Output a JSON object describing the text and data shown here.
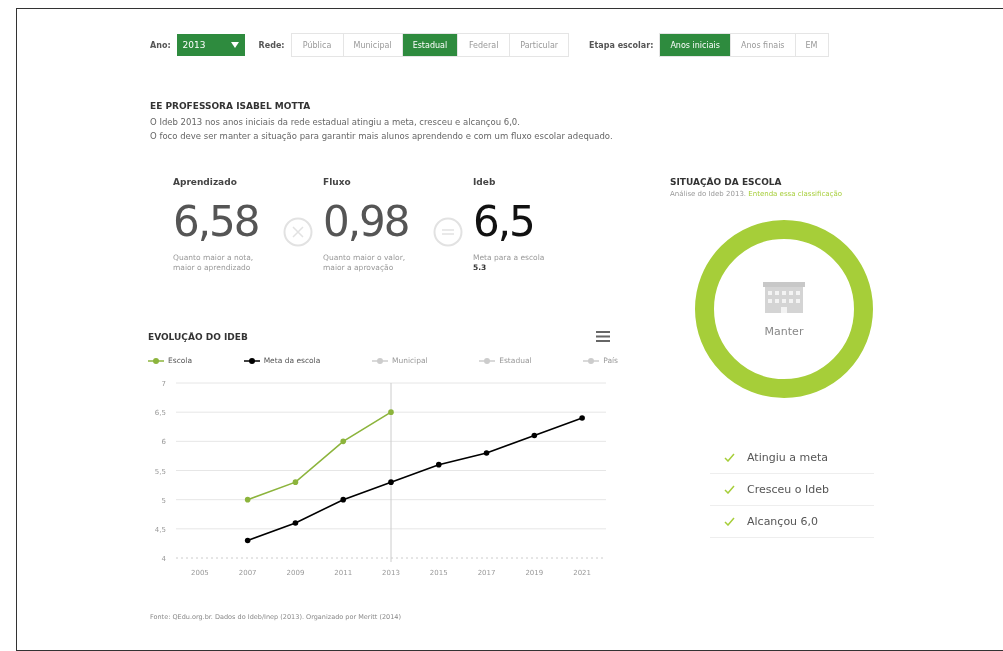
{
  "filters": {
    "year": {
      "label": "Ano:",
      "value": "2013"
    },
    "network": {
      "label": "Rede:",
      "options": [
        {
          "label": "Pública",
          "selected": false
        },
        {
          "label": "Municipal",
          "selected": false
        },
        {
          "label": "Estadual",
          "selected": true
        },
        {
          "label": "Federal",
          "selected": false
        },
        {
          "label": "Particular",
          "selected": false
        }
      ]
    },
    "stage": {
      "label": "Etapa escolar:",
      "options": [
        {
          "label": "Anos iniciais",
          "selected": true
        },
        {
          "label": "Anos finais",
          "selected": false
        },
        {
          "label": "EM",
          "selected": false
        }
      ]
    }
  },
  "school": {
    "name": "EE PROFESSORA ISABEL MOTTA",
    "lines": [
      "O Ideb 2013 nos anos iniciais da rede estadual atingiu a meta, cresceu e alcançou 6,0.",
      "O foco deve ser manter a situação para garantir mais alunos aprendendo e com um fluxo escolar adequado."
    ]
  },
  "stats": [
    {
      "label": "Aprendizado",
      "value": "6,58",
      "note": "Quanto maior a nota, maior o aprendizado"
    },
    {
      "label": "Fluxo",
      "value": "0,98",
      "note": "Quanto maior o valor, maior a aprovação"
    },
    {
      "label": "Ideb",
      "value": "6,5",
      "note": "Meta para a escola",
      "goal": "5.3"
    }
  ],
  "situation": {
    "title": "SITUAÇÃO DA ESCOLA",
    "subtitle": "Análise do Ideb 2013.",
    "link": "Entenda essa classificação",
    "status": "Manter",
    "color": "#a6ce39",
    "checks": [
      {
        "label": "Atingiu a meta",
        "checked": true
      },
      {
        "label": "Cresceu o Ideb",
        "checked": true
      },
      {
        "label": "Alcançou 6,0",
        "checked": true
      }
    ]
  },
  "evolution": {
    "title": "EVOLUÇÃO DO IDEB",
    "chart_data": {
      "type": "line",
      "categories": [
        "2005",
        "2007",
        "2009",
        "2011",
        "2013",
        "2015",
        "2017",
        "2019",
        "2021"
      ],
      "series": [
        {
          "name": "Escola",
          "color": "#8cb43c",
          "values": [
            null,
            5.0,
            5.3,
            6.0,
            6.5,
            null,
            null,
            null,
            null
          ]
        },
        {
          "name": "Meta da escola",
          "color": "#000000",
          "values": [
            null,
            4.3,
            4.6,
            5.0,
            5.3,
            5.6,
            5.8,
            6.1,
            6.4
          ]
        }
      ],
      "grid": true,
      "ylim": [
        4,
        7
      ],
      "yticks": [
        {
          "value": 4,
          "label": "4"
        },
        {
          "value": 4.5,
          "label": "4,5"
        },
        {
          "value": 5,
          "label": "5"
        },
        {
          "value": 5.5,
          "label": "5,5"
        },
        {
          "value": 6,
          "label": "6"
        },
        {
          "value": 6.5,
          "label": "6,5"
        },
        {
          "value": 7,
          "label": "7"
        }
      ],
      "ref_lines": [
        {
          "axis": "x",
          "value": "2013"
        }
      ]
    },
    "hidden_series": [
      {
        "label": "Municipal",
        "color": "#cccccc"
      },
      {
        "label": "Estadual",
        "color": "#cccccc"
      },
      {
        "label": "País",
        "color": "#cccccc"
      }
    ]
  },
  "source": "Fonte: QEdu.org.br. Dados do Ideb/Inep (2013). Organizado por Meritt (2014)"
}
